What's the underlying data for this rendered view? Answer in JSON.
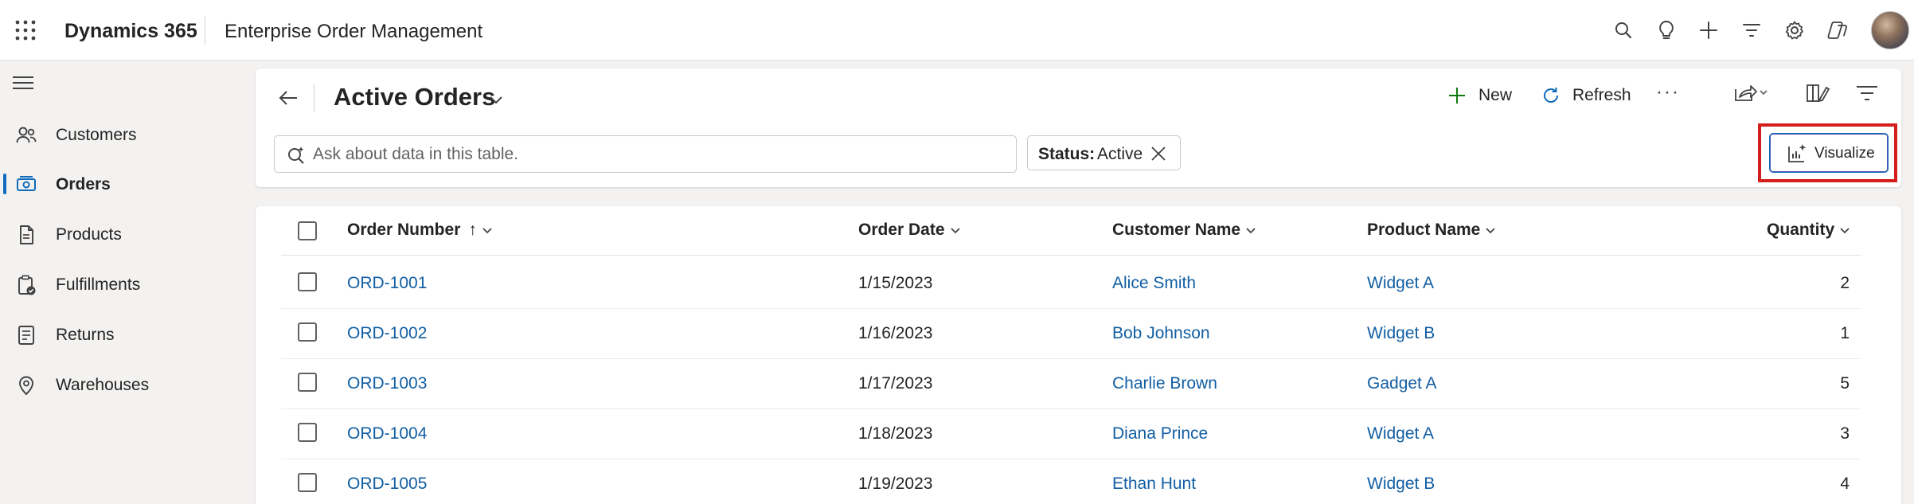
{
  "header": {
    "app_name": "Dynamics 365",
    "app_subtitle": "Enterprise Order Management",
    "icons": [
      "waffle-icon",
      "search-icon",
      "lightbulb-icon",
      "plus-icon",
      "filter-icon",
      "gear-icon",
      "copilot-icon",
      "avatar"
    ]
  },
  "sidebar": {
    "items": [
      {
        "label": "Customers",
        "icon": "people-icon"
      },
      {
        "label": "Orders",
        "icon": "orders-icon",
        "active": true
      },
      {
        "label": "Products",
        "icon": "document-icon"
      },
      {
        "label": "Fulfillments",
        "icon": "clipboard-check-icon"
      },
      {
        "label": "Returns",
        "icon": "list-doc-icon"
      },
      {
        "label": "Warehouses",
        "icon": "location-icon"
      }
    ]
  },
  "command_bar": {
    "view_title": "Active Orders",
    "new_label": "New",
    "refresh_label": "Refresh",
    "more_label": "···"
  },
  "search": {
    "placeholder": "Ask about data in this table."
  },
  "filter": {
    "key": "Status:",
    "value": "Active"
  },
  "visualize": {
    "label": "Visualize"
  },
  "grid": {
    "columns": [
      "Order Number",
      "Order Date",
      "Customer Name",
      "Product Name",
      "Quantity"
    ],
    "sort_indicator": "↑",
    "rows": [
      {
        "order": "ORD-1001",
        "date": "1/15/2023",
        "customer": "Alice Smith",
        "product": "Widget A",
        "qty": "2"
      },
      {
        "order": "ORD-1002",
        "date": "1/16/2023",
        "customer": "Bob Johnson",
        "product": "Widget B",
        "qty": "1"
      },
      {
        "order": "ORD-1003",
        "date": "1/17/2023",
        "customer": "Charlie Brown",
        "product": "Gadget A",
        "qty": "5"
      },
      {
        "order": "ORD-1004",
        "date": "1/18/2023",
        "customer": "Diana Prince",
        "product": "Widget A",
        "qty": "3"
      },
      {
        "order": "ORD-1005",
        "date": "1/19/2023",
        "customer": "Ethan Hunt",
        "product": "Widget B",
        "qty": "4"
      }
    ]
  },
  "colors": {
    "accent": "#0f6cbd",
    "link": "#115ea3",
    "highlight": "#d41e1e",
    "new_plus": "#107c10"
  }
}
